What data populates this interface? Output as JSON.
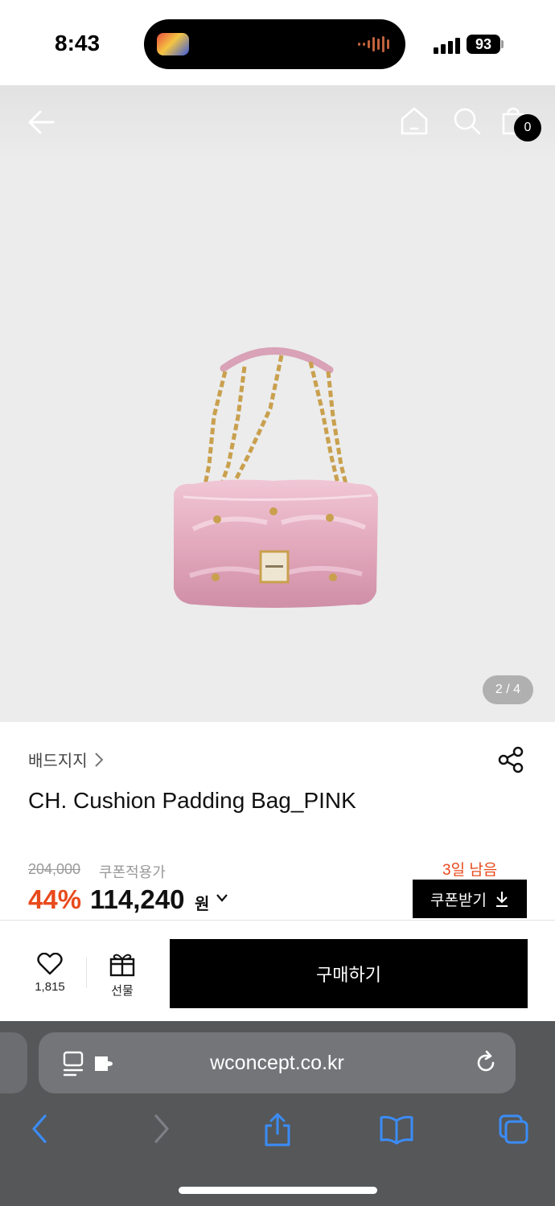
{
  "status_bar": {
    "time": "8:43",
    "battery": "93"
  },
  "hero": {
    "cart_count": "0",
    "image_counter": "2 / 4",
    "icons": [
      "back-arrow-icon",
      "home-icon",
      "search-icon",
      "shopping-bag-icon"
    ]
  },
  "product": {
    "brand": "배드지지",
    "name": "CH. Cushion Padding Bag_PINK",
    "original_price": "204,000",
    "coupon_applied_label": "쿠폰적용가",
    "discount": "44%",
    "price": "114,240",
    "currency": "원",
    "days_left": "3일 남음",
    "coupon_button": "쿠폰받기"
  },
  "purchase_bar": {
    "like_count": "1,815",
    "gift_label": "선물",
    "buy_label": "구매하기"
  },
  "browser": {
    "url": "wconcept.co.kr"
  },
  "colors": {
    "accent": "#e84a1c",
    "button": "#000000",
    "product_pink": "#e7b3c6",
    "chain_gold": "#c9a04e"
  }
}
